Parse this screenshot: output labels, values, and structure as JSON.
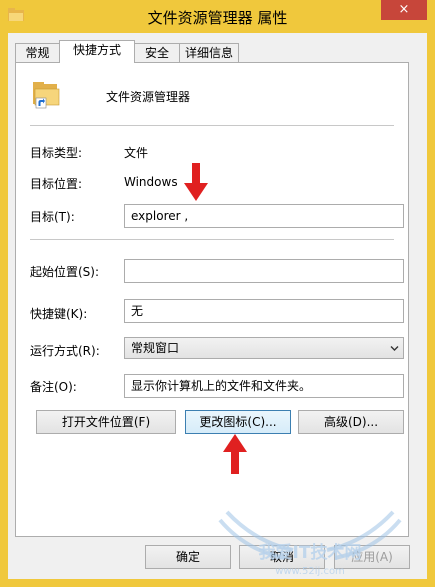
{
  "window": {
    "title": "文件资源管理器 属性",
    "close_glyph": "×",
    "accent_color": "#f0c83c",
    "close_color": "#c7463a"
  },
  "tabs": [
    {
      "label": "常规",
      "active": false
    },
    {
      "label": "快捷方式",
      "active": true
    },
    {
      "label": "安全",
      "active": false
    },
    {
      "label": "详细信息",
      "active": false
    }
  ],
  "shortcut": {
    "icon": "file-explorer-shortcut-icon",
    "name": "文件资源管理器",
    "target_type_label": "目标类型:",
    "target_type_value": "文件",
    "target_location_label": "目标位置:",
    "target_location_value": "Windows",
    "target_label": "目标(T):",
    "target_value": "explorer ,",
    "start_in_label": "起始位置(S):",
    "start_in_value": "",
    "hotkey_label": "快捷键(K):",
    "hotkey_value": "无",
    "run_label": "运行方式(R):",
    "run_value": "常规窗口",
    "comment_label": "备注(O):",
    "comment_value": "显示你计算机上的文件和文件夹。",
    "open_location_button": "打开文件位置(F)",
    "change_icon_button": "更改图标(C)...",
    "advanced_button": "高级(D)..."
  },
  "footer": {
    "ok_button": "确定",
    "cancel_button": "取消",
    "apply_button": "应用(A)"
  },
  "annotations": {
    "arrow_color": "#e02020",
    "arrows": [
      "arrow-down-to-target",
      "arrow-up-to-change-icon"
    ]
  },
  "watermark": {
    "text": "我爱IT技术网",
    "subtext": "www.52ij.com"
  }
}
